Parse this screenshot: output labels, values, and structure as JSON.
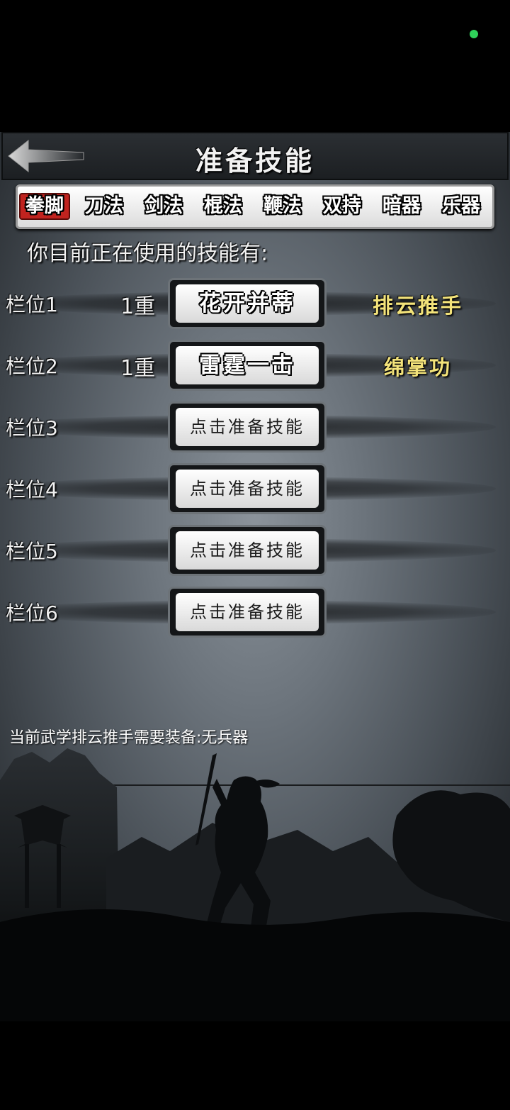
{
  "header": {
    "title": "准备技能",
    "back": "back-arrow-icon"
  },
  "tabs": [
    {
      "label": "拳脚",
      "active": true
    },
    {
      "label": "刀法",
      "active": false
    },
    {
      "label": "剑法",
      "active": false
    },
    {
      "label": "棍法",
      "active": false
    },
    {
      "label": "鞭法",
      "active": false
    },
    {
      "label": "双持",
      "active": false
    },
    {
      "label": "暗器",
      "active": false
    },
    {
      "label": "乐器",
      "active": false
    }
  ],
  "subtitle": "你目前正在使用的技能有:",
  "slots": [
    {
      "label": "栏位1",
      "level": "1重",
      "button": "花开并蒂",
      "skill": "排云推手"
    },
    {
      "label": "栏位2",
      "level": "1重",
      "button": "雷霆一击",
      "skill": "绵掌功"
    },
    {
      "label": "栏位3",
      "level": "",
      "button": "点击准备技能",
      "skill": ""
    },
    {
      "label": "栏位4",
      "level": "",
      "button": "点击准备技能",
      "skill": ""
    },
    {
      "label": "栏位5",
      "level": "",
      "button": "点击准备技能",
      "skill": ""
    },
    {
      "label": "栏位6",
      "level": "",
      "button": "点击准备技能",
      "skill": ""
    }
  ],
  "equip_note": "当前武学排云推手需要装备:无兵器",
  "colors": {
    "active_tab": "#c0231f",
    "skill_name": "#f3e37a",
    "status_dot": "#2fd25a"
  }
}
